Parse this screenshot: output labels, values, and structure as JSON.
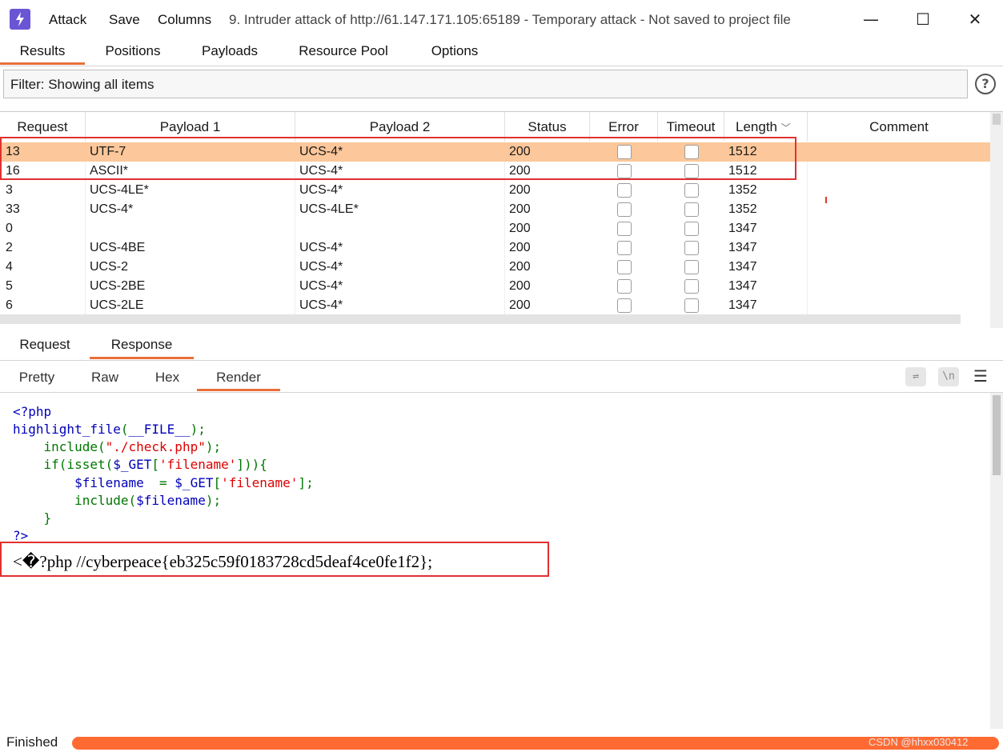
{
  "menu": {
    "attack": "Attack",
    "save": "Save",
    "columns": "Columns"
  },
  "window": {
    "title": "9. Intruder attack of http://61.147.171.105:65189 - Temporary attack - Not saved to project file",
    "minimize": "—",
    "maximize": "☐",
    "close": "✕"
  },
  "tabs": [
    "Results",
    "Positions",
    "Payloads",
    "Resource Pool",
    "Options"
  ],
  "filter": {
    "text": "Filter: Showing all items",
    "help": "?"
  },
  "table": {
    "headers": [
      "Request",
      "Payload 1",
      "Payload 2",
      "Status",
      "Error",
      "Timeout",
      "Length",
      "Comment"
    ],
    "sort_indicator": "﹀",
    "rows": [
      {
        "request": "13",
        "p1": "UTF-7",
        "p2": "UCS-4*",
        "status": "200",
        "length": "1512",
        "selected": true
      },
      {
        "request": "16",
        "p1": "ASCII*",
        "p2": "UCS-4*",
        "status": "200",
        "length": "1512"
      },
      {
        "request": "3",
        "p1": "UCS-4LE*",
        "p2": "UCS-4*",
        "status": "200",
        "length": "1352"
      },
      {
        "request": "33",
        "p1": "UCS-4*",
        "p2": "UCS-4LE*",
        "status": "200",
        "length": "1352"
      },
      {
        "request": "0",
        "p1": "",
        "p2": "",
        "status": "200",
        "length": "1347"
      },
      {
        "request": "2",
        "p1": "UCS-4BE",
        "p2": "UCS-4*",
        "status": "200",
        "length": "1347"
      },
      {
        "request": "4",
        "p1": "UCS-2",
        "p2": "UCS-4*",
        "status": "200",
        "length": "1347"
      },
      {
        "request": "5",
        "p1": "UCS-2BE",
        "p2": "UCS-4*",
        "status": "200",
        "length": "1347"
      },
      {
        "request": "6",
        "p1": "UCS-2LE",
        "p2": "UCS-4*",
        "status": "200",
        "length": "1347"
      }
    ]
  },
  "rr_tabs": [
    "Request",
    "Response"
  ],
  "view_tabs": [
    "Pretty",
    "Raw",
    "Hex",
    "Render"
  ],
  "toolbar": {
    "wrap": "⇌",
    "newline": "\\n",
    "menu": "☰"
  },
  "code": {
    "l1": "<?php",
    "l2a": "highlight_file",
    "l2b": "(",
    "l2c": "__FILE__",
    "l2d": ");",
    "l3a": "    include",
    "l3b": "(",
    "l3c": "\"./check.php\"",
    "l3d": ");",
    "l4a": "    if(isset(",
    "l4b": "$_GET",
    "l4c": "[",
    "l4d": "'filename'",
    "l4e": "])){",
    "l5a": "        $filename",
    "l5b": "  = ",
    "l5c": "$_GET",
    "l5d": "[",
    "l5e": "'filename'",
    "l5f": "];",
    "l6a": "        include(",
    "l6b": "$filename",
    "l6c": ");",
    "l7": "    }",
    "l8": "?>"
  },
  "flag_line": "<�?php //cyberpeace{eb325c59f0183728cd5deaf4ce0fe1f2};",
  "status": {
    "text": "Finished",
    "progress": 1.0
  },
  "watermark": "CSDN @hhxx030412",
  "colors": {
    "accent": "#e8703a",
    "selected_row": "#fcc79a",
    "highlight_box": "#e0312f",
    "progress": "#ff6a33",
    "app_icon": "#6a55d4"
  }
}
